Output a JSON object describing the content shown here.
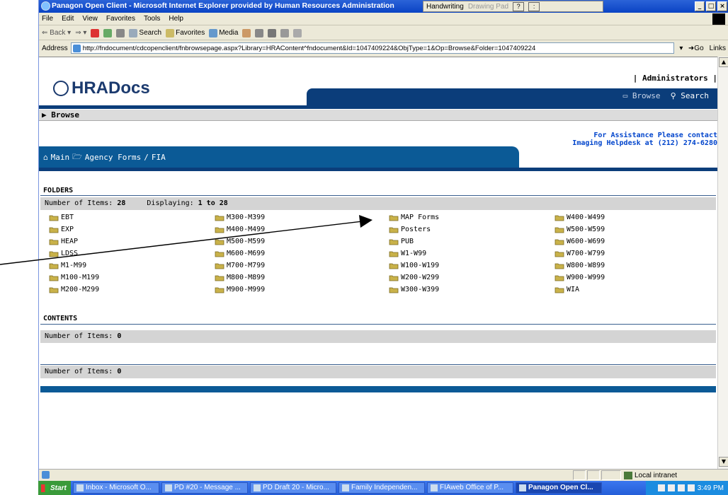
{
  "window": {
    "title": "Panagon Open Client - Microsoft Internet Explorer provided by Human Resources Administration",
    "ink_bar": {
      "handwriting": "Handwriting",
      "drawing_pad": "Drawing Pad",
      "help": "?"
    }
  },
  "menu": [
    "File",
    "Edit",
    "View",
    "Favorites",
    "Tools",
    "Help"
  ],
  "toolbar": {
    "back": "Back",
    "search": "Search",
    "favorites": "Favorites",
    "media": "Media"
  },
  "address": {
    "label": "Address",
    "url": "http://fndocument/cdcopenclient/fnbrowsepage.aspx?Library=HRAContent^fndocument&Id=1047409224&ObjType=1&Op=Browse&Folder=1047409224",
    "go": "Go",
    "links": "Links"
  },
  "header": {
    "logo": "HRADocs",
    "admins": "Administrators",
    "nav_browse": "Browse",
    "nav_search": "Search"
  },
  "browse_bar": "Browse",
  "assistance": {
    "line1": "For Assistance Please contact",
    "line2": "Imaging Helpdesk at (212) 274-6280"
  },
  "breadcrumb": {
    "main": "Main",
    "agency_forms": "Agency Forms",
    "sep": "/",
    "current": "FIA"
  },
  "folders_section": {
    "title": "FOLDERS",
    "count_label": "Number of Items:",
    "count": "28",
    "display_label": "Displaying:",
    "display_range": "1 to 28",
    "items": [
      "EBT",
      "M300-M399",
      "MAP Forms",
      "W400-W499",
      "EXP",
      "M400-M499",
      "Posters",
      "W500-W599",
      "HEAP",
      "M500-M599",
      "PUB",
      "W600-W699",
      "LDSS",
      "M600-M699",
      "W1-W99",
      "W700-W799",
      "M1-M99",
      "M700-M799",
      "W100-W199",
      "W800-W899",
      "M100-M199",
      "M800-M899",
      "W200-W299",
      "W900-W999",
      "M200-M299",
      "M900-M999",
      "W300-W399",
      "WIA"
    ]
  },
  "contents_section": {
    "title": "CONTENTS",
    "count_label": "Number of Items:",
    "count": "0",
    "count2_label": "Number of Items:",
    "count2": "0"
  },
  "status": {
    "zone": "Local intranet"
  },
  "taskbar": {
    "start": "Start",
    "tasks": [
      "Inbox - Microsoft O...",
      "PD #20 - Message ...",
      "PD Draft 20 - Micro...",
      "Family Independen...",
      "FIAweb Office of P...",
      "Panagon Open Cl..."
    ],
    "time": "3:49 PM"
  },
  "colors": {
    "navy": "#0b3d7a",
    "blue_band": "#0b5a96",
    "link_blue": "#0044cc",
    "folder": "#c9b24a"
  }
}
